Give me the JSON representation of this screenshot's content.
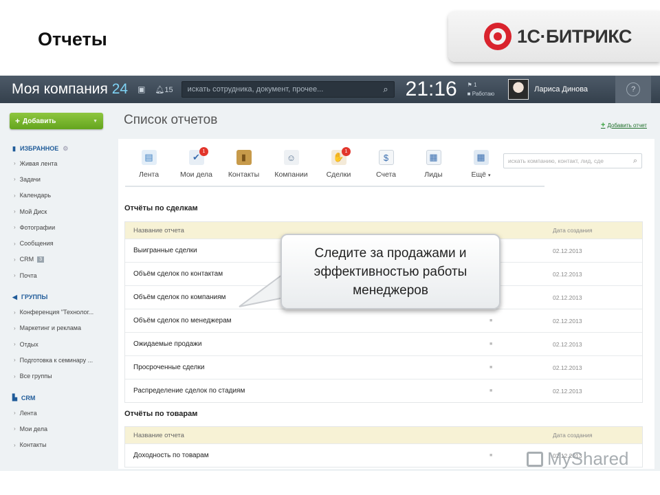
{
  "slide": {
    "title": "Отчеты",
    "brand": "1С·БИТРИКС"
  },
  "header": {
    "company": "Моя компания",
    "company_num": "24",
    "notifications": "15",
    "search_placeholder": "искать сотрудника, документ, прочее...",
    "time": "21:16",
    "status_count": "1",
    "status_text": "Работаю",
    "user_name": "Лариса Динова",
    "help": "?"
  },
  "sidebar": {
    "add_button": "Добавить",
    "favorites_title": "ИЗБРАННОЕ",
    "favorites": [
      "Живая лента",
      "Задачи",
      "Календарь",
      "Мой Диск",
      "Фотографии",
      "Сообщения",
      "CRM",
      "Почта"
    ],
    "crm_badge": "3",
    "groups_title": "ГРУППЫ",
    "groups": [
      "Конференция \"Технолог...",
      "Маркетинг и реклама",
      "Отдых",
      "Подготовка к семинару ...",
      "Все группы"
    ],
    "crm_title": "CRM",
    "crm_items": [
      "Лента",
      "Мои дела",
      "Контакты"
    ]
  },
  "main": {
    "title": "Список отчетов",
    "add_report": "Добавить отчет",
    "toolbar": [
      {
        "label": "Лента",
        "icon": "feed-icon"
      },
      {
        "label": "Мои дела",
        "icon": "tasks-icon",
        "badge": "1"
      },
      {
        "label": "Контакты",
        "icon": "contacts-icon"
      },
      {
        "label": "Компании",
        "icon": "companies-icon"
      },
      {
        "label": "Сделки",
        "icon": "deals-icon",
        "badge": "1"
      },
      {
        "label": "Счета",
        "icon": "invoices-icon"
      },
      {
        "label": "Лиды",
        "icon": "leads-icon"
      },
      {
        "label": "Ещё",
        "icon": "more-icon"
      }
    ],
    "crm_search_placeholder": "искать компанию, контакт, лид, сде",
    "deals_group": "Отчёты по сделкам",
    "col_name": "Название отчета",
    "col_date": "Дата создания",
    "deals_reports": [
      {
        "name": "Выигранные сделки",
        "date": "02.12.2013"
      },
      {
        "name": "Объём сделок по контактам",
        "date": "02.12.2013"
      },
      {
        "name": "Объём сделок по компаниям",
        "date": "02.12.2013"
      },
      {
        "name": "Объём сделок по менеджерам",
        "date": "02.12.2013"
      },
      {
        "name": "Ожидаемые продажи",
        "date": "02.12.2013"
      },
      {
        "name": "Просроченные сделки",
        "date": "02.12.2013"
      },
      {
        "name": "Распределение сделок по стадиям",
        "date": "02.12.2013"
      }
    ],
    "goods_group": "Отчёты по товарам",
    "goods_reports": [
      {
        "name": "Доходность по товарам",
        "date": "02.12.2013"
      }
    ]
  },
  "callout": "Следите за продажами и эффективностью работы менеджеров",
  "watermark": "MyShared"
}
